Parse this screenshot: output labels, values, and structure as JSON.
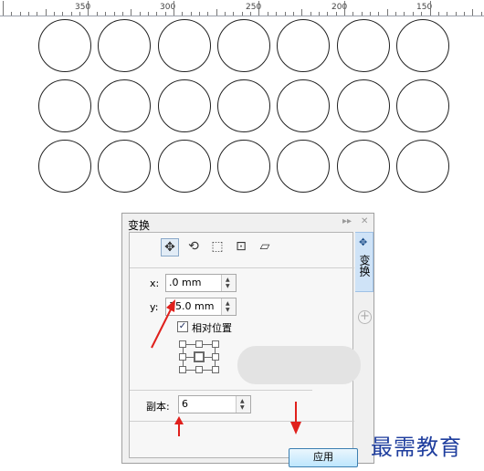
{
  "ruler": {
    "labels": [
      "350",
      "300",
      "250",
      "200",
      "150"
    ]
  },
  "canvas": {
    "rows": 3,
    "columns": 7
  },
  "panel": {
    "title": "变换",
    "side_tab_label": "变换",
    "mode_icons": [
      "position-icon",
      "rotate-icon",
      "scale-icon",
      "size-icon",
      "skew-icon"
    ],
    "x_label": "x:",
    "x_value": ".0 mm",
    "y_label": "y:",
    "y_value": "35.0 mm",
    "relative_position_label": "相对位置",
    "relative_position_checked": true,
    "copies_label": "副本:",
    "copies_value": "6",
    "apply_label": "应用"
  },
  "annotations": {
    "arrow_color": "#e0201c"
  },
  "watermark": "最需教育"
}
